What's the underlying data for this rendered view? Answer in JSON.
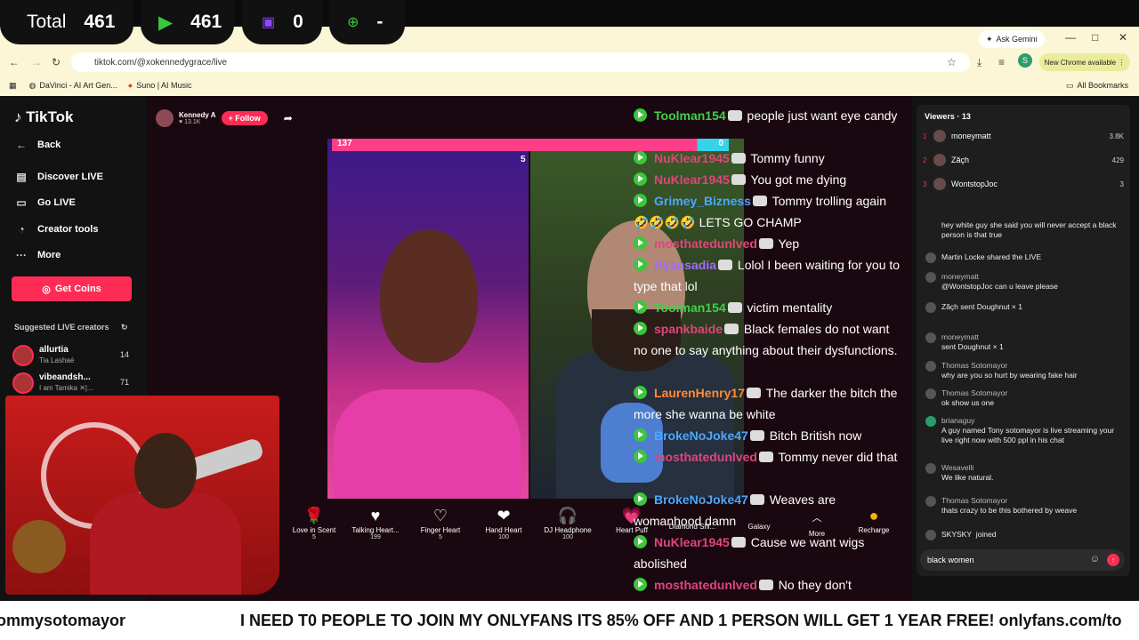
{
  "stats": {
    "total_label": "Total",
    "total_value": "461",
    "youtube_value": "461",
    "twitch_value": "0",
    "web_value": "-"
  },
  "browser": {
    "url": "tiktok.com/@xokennedygrace/live",
    "ask_gemini": "Ask Gemini",
    "new_chrome": "New Chrome available",
    "bookmarks": [
      "DaVinci - AI Art Gen...",
      "Suno | AI Music"
    ],
    "all_bookmarks": "All Bookmarks"
  },
  "sidebar": {
    "logo": "TikTok",
    "back": "Back",
    "items": [
      "Discover LIVE",
      "Go LIVE",
      "Creator tools",
      "More"
    ],
    "coins": "Get Coins",
    "suggested_title": "Suggested LIVE creators",
    "creators": [
      {
        "name": "allurtia",
        "sub": "Tia Lashaé",
        "count": "14"
      },
      {
        "name": "vibeandsh...",
        "sub": "I am Tamika ✕|...",
        "count": "71"
      }
    ]
  },
  "stage": {
    "host_name": "Kennedy A",
    "host_likes": "13.1K",
    "follow": "+ Follow",
    "battle_left": "137",
    "battle_right": "0",
    "guest_count": "5",
    "gifts": [
      {
        "name": "Love in Scent",
        "price": "5"
      },
      {
        "name": "Talking Heart...",
        "price": "199"
      },
      {
        "name": "Finger Heart",
        "price": "5"
      },
      {
        "name": "Hand Heart",
        "price": "100"
      },
      {
        "name": "DJ Headphone",
        "price": "100"
      },
      {
        "name": "Heart Puff",
        "price": ""
      },
      {
        "name": "Diamond Shi...",
        "price": ""
      },
      {
        "name": "Galaxy",
        "price": ""
      },
      {
        "name": "More",
        "price": ""
      },
      {
        "name": "Recharge",
        "price": ""
      }
    ]
  },
  "overlay_chat": [
    {
      "user": "Toolman154",
      "color": "#3fd14a",
      "text": "people just want eye candy"
    },
    {
      "user": "NuKlear1945",
      "color": "#e0457b",
      "text": "Tommy funny"
    },
    {
      "user": "NuKlear1945",
      "color": "#e0457b",
      "text": "You got me dying"
    },
    {
      "user": "Grimey_Bizness",
      "color": "#4aa8ff",
      "text": "Tommy trolling again 🤣🤣🤣🤣 LETS GO CHAMP"
    },
    {
      "user": "mosthatedunlved",
      "color": "#e0457b",
      "text": "Yep"
    },
    {
      "user": "Ryansadia",
      "color": "#a06bff",
      "text": "Lolol I been waiting for you to type that lol"
    },
    {
      "user": "Toolman154",
      "color": "#3fd14a",
      "text": "victim mentality"
    },
    {
      "user": "spankbaide",
      "color": "#e0457b",
      "text": "Black females do not want no one to say anything about their dysfunctions."
    },
    {
      "user": "LaurenHenry17",
      "color": "#ff8a3d",
      "text": "The darker the bitch the more she wanna be white"
    },
    {
      "user": "BrokeNoJoke47",
      "color": "#4aa8ff",
      "text": "Bitch British now"
    },
    {
      "user": "mosthatedunlved",
      "color": "#e0457b",
      "text": "Tommy never did that"
    },
    {
      "user": "BrokeNoJoke47",
      "color": "#4aa8ff",
      "text": "Weaves are womanhood damn"
    },
    {
      "user": "NuKlear1945",
      "color": "#e0457b",
      "text": "Cause we want wigs abolished"
    },
    {
      "user": "mosthatedunlved",
      "color": "#e0457b",
      "text": "No they don't"
    }
  ],
  "viewers": {
    "title": "Viewers · 13",
    "top": [
      {
        "rank": "1",
        "name": "moneymatt",
        "score": "3.8K"
      },
      {
        "rank": "2",
        "name": "Zăçh",
        "score": "429"
      },
      {
        "rank": "3",
        "name": "WontstopJoc",
        "score": "3"
      }
    ],
    "comments": [
      {
        "user": "",
        "text": "hey white guy she said you will never accept a black person is that true"
      },
      {
        "user": "Martin Locke",
        "text": "shared the LIVE"
      },
      {
        "user": "moneymatt",
        "text": "@WontstopJoc can u leave please"
      },
      {
        "user": "Zăçh",
        "text": "sent Doughnut × 1"
      },
      {
        "user": "moneymatt",
        "text": "sent Doughnut × 1"
      },
      {
        "user": "Thomas Sotomayor",
        "text": "why are you so hurt by wearing fake hair"
      },
      {
        "user": "Thomas Sotomayor",
        "text": "ok show us one"
      },
      {
        "user": "brianaguy",
        "text": "A guy named Tony sotomayor is live streaming your live right now with 500 ppl in his chat"
      },
      {
        "user": "Wesavelli",
        "text": "We like natural."
      },
      {
        "user": "Thomas Sotomayor",
        "text": "thats crazy to be this bothered by weave"
      },
      {
        "user": "SKYSKY",
        "text": "joined"
      }
    ],
    "input_value": "black women"
  },
  "ticker": {
    "left": "ommysotomayor",
    "main": "I NEED T0 PEOPLE TO JOIN MY ONLYFANS ITS 85% OFF AND 1 PERSON WILL GET 1 YEAR FREE! onlyfans.com/to"
  }
}
